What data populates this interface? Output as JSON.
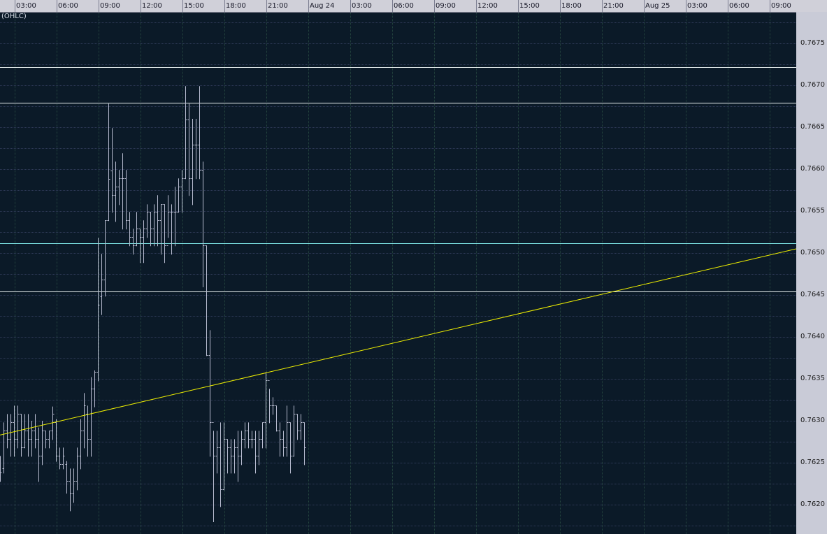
{
  "indicator_label": "(OHLC)",
  "colors": {
    "background": "#0b1a28",
    "bar": "#b8bcd0",
    "trendline": "#f0f000",
    "level_white": "#e8f0f0",
    "level_cyan": "#7fe8e8"
  },
  "chart_data": {
    "type": "ohlc",
    "time_labels": [
      "03:00",
      "06:00",
      "09:00",
      "12:00",
      "15:00",
      "18:00",
      "21:00",
      "Aug 24",
      "03:00",
      "06:00",
      "09:00",
      "12:00",
      "15:00",
      "18:00",
      "21:00",
      "Aug 25",
      "03:00",
      "06:00",
      "09:00"
    ],
    "price_labels": [
      "0.7675",
      "0.7670",
      "0.7665",
      "0.7660",
      "0.7655",
      "0.7650",
      "0.7645",
      "0.7640",
      "0.7635",
      "0.7630",
      "0.7625",
      "0.7620"
    ],
    "ylim": [
      0.76153,
      0.76802
    ],
    "bar_interval_minutes": 15,
    "first_bar_offset_bars": -4.2,
    "bars": [
      [
        0.76248,
        0.76258,
        0.76228,
        0.76238
      ],
      [
        0.76243,
        0.76298,
        0.76238,
        0.76288
      ],
      [
        0.76288,
        0.76308,
        0.76268,
        0.76278
      ],
      [
        0.76278,
        0.76308,
        0.76258,
        0.76298
      ],
      [
        0.76298,
        0.76318,
        0.76258,
        0.76278
      ],
      [
        0.76278,
        0.76318,
        0.76268,
        0.76308
      ],
      [
        0.76308,
        0.76308,
        0.76258,
        0.76268
      ],
      [
        0.76268,
        0.76308,
        0.76268,
        0.76288
      ],
      [
        0.76288,
        0.76308,
        0.76258,
        0.76278
      ],
      [
        0.76278,
        0.763,
        0.76258,
        0.76288
      ],
      [
        0.76288,
        0.76308,
        0.76268,
        0.76278
      ],
      [
        0.76278,
        0.76292,
        0.76228,
        0.76258
      ],
      [
        0.76258,
        0.763,
        0.76248,
        0.76288
      ],
      [
        0.76288,
        0.76288,
        0.76268,
        0.76278
      ],
      [
        0.76278,
        0.76288,
        0.76268,
        0.76288
      ],
      [
        0.76288,
        0.76317,
        0.76278,
        0.76308
      ],
      [
        0.76298,
        0.76302,
        0.76252,
        0.76258
      ],
      [
        0.76258,
        0.76268,
        0.76243,
        0.76248
      ],
      [
        0.76248,
        0.76268,
        0.76243,
        0.76258
      ],
      [
        0.76248,
        0.76252,
        0.76214,
        0.76228
      ],
      [
        0.76228,
        0.76243,
        0.76193,
        0.76213
      ],
      [
        0.76213,
        0.76243,
        0.76203,
        0.76228
      ],
      [
        0.76228,
        0.76268,
        0.76218,
        0.76258
      ],
      [
        0.76258,
        0.76302,
        0.76243,
        0.76288
      ],
      [
        0.76288,
        0.76333,
        0.76268,
        0.76318
      ],
      [
        0.76308,
        0.76318,
        0.76258,
        0.76278
      ],
      [
        0.76278,
        0.76352,
        0.76258,
        0.76338
      ],
      [
        0.76338,
        0.7636,
        0.76317,
        0.76358
      ],
      [
        0.76358,
        0.76518,
        0.76348,
        0.76438
      ],
      [
        0.76448,
        0.76499,
        0.76427,
        0.76468
      ],
      [
        0.76468,
        0.76539,
        0.76449,
        0.76539
      ],
      [
        0.76539,
        0.76678,
        0.76539,
        0.76588
      ],
      [
        0.76598,
        0.76649,
        0.76549,
        0.76569
      ],
      [
        0.76569,
        0.76609,
        0.76538,
        0.76579
      ],
      [
        0.76579,
        0.76599,
        0.76558,
        0.76589
      ],
      [
        0.76589,
        0.76619,
        0.76529,
        0.76589
      ],
      [
        0.76589,
        0.76599,
        0.76529,
        0.76539
      ],
      [
        0.76539,
        0.76549,
        0.76509,
        0.76519
      ],
      [
        0.76519,
        0.76529,
        0.76499,
        0.76509
      ],
      [
        0.76509,
        0.76549,
        0.76509,
        0.76529
      ],
      [
        0.76529,
        0.76529,
        0.76489,
        0.76519
      ],
      [
        0.76519,
        0.76539,
        0.76489,
        0.76529
      ],
      [
        0.76529,
        0.76558,
        0.76519,
        0.76549
      ],
      [
        0.76549,
        0.76549,
        0.76509,
        0.76529
      ],
      [
        0.76529,
        0.76558,
        0.76509,
        0.76549
      ],
      [
        0.76549,
        0.76569,
        0.76509,
        0.76539
      ],
      [
        0.76539,
        0.76558,
        0.76499,
        0.76558
      ],
      [
        0.76558,
        0.76558,
        0.76489,
        0.76509
      ],
      [
        0.76509,
        0.76569,
        0.76519,
        0.76549
      ],
      [
        0.76549,
        0.76558,
        0.76499,
        0.76549
      ],
      [
        0.76549,
        0.76579,
        0.76509,
        0.76549
      ],
      [
        0.76549,
        0.76589,
        0.76549,
        0.76579
      ],
      [
        0.76579,
        0.76599,
        0.76549,
        0.76589
      ],
      [
        0.76589,
        0.76699,
        0.76589,
        0.76659
      ],
      [
        0.76659,
        0.76678,
        0.76569,
        0.76589
      ],
      [
        0.76589,
        0.7666,
        0.76558,
        0.76629
      ],
      [
        0.76629,
        0.7666,
        0.76589,
        0.76629
      ],
      [
        0.76629,
        0.76699,
        0.76589,
        0.76599
      ],
      [
        0.76599,
        0.76609,
        0.7646,
        0.76509
      ],
      [
        0.76509,
        0.76509,
        0.76378,
        0.76378
      ],
      [
        0.76378,
        0.76408,
        0.76258,
        0.76298
      ],
      [
        0.76298,
        0.76288,
        0.7618,
        0.76258
      ],
      [
        0.76258,
        0.76288,
        0.76238,
        0.76268
      ],
      [
        0.76268,
        0.76298,
        0.76198,
        0.76218
      ],
      [
        0.76218,
        0.76298,
        0.76218,
        0.76278
      ],
      [
        0.76278,
        0.76278,
        0.76238,
        0.76268
      ],
      [
        0.76268,
        0.76278,
        0.76238,
        0.76258
      ],
      [
        0.76258,
        0.76278,
        0.76238,
        0.76268
      ],
      [
        0.76268,
        0.76288,
        0.76228,
        0.76258
      ],
      [
        0.76258,
        0.76288,
        0.76248,
        0.76278
      ],
      [
        0.76278,
        0.76298,
        0.76268,
        0.76288
      ],
      [
        0.76288,
        0.76298,
        0.76268,
        0.76278
      ],
      [
        0.76278,
        0.76288,
        0.76268,
        0.76278
      ],
      [
        0.76278,
        0.76288,
        0.76238,
        0.76258
      ],
      [
        0.76258,
        0.76288,
        0.76248,
        0.76278
      ],
      [
        0.76278,
        0.76298,
        0.76268,
        0.76298
      ],
      [
        0.76298,
        0.76358,
        0.76268,
        0.76348
      ],
      [
        0.76348,
        0.76338,
        0.76298,
        0.76318
      ],
      [
        0.76318,
        0.76328,
        0.76308,
        0.76318
      ],
      [
        0.76318,
        0.76318,
        0.76288,
        0.76288
      ],
      [
        0.76288,
        0.76298,
        0.76258,
        0.76278
      ],
      [
        0.76278,
        0.76288,
        0.76258,
        0.76268
      ],
      [
        0.76268,
        0.76318,
        0.76258,
        0.76298
      ],
      [
        0.76298,
        0.76298,
        0.76238,
        0.76258
      ],
      [
        0.76258,
        0.76318,
        0.76258,
        0.76308
      ],
      [
        0.76308,
        0.76308,
        0.76278,
        0.76288
      ],
      [
        0.76288,
        0.76308,
        0.76278,
        0.76298
      ],
      [
        0.76298,
        0.76298,
        0.76248,
        0.76268
      ]
    ],
    "horizontal_levels": [
      {
        "price": 0.76722,
        "color": "#e8f0f0"
      },
      {
        "price": 0.76679,
        "color": "#e8f0f0"
      },
      {
        "price": 0.76512,
        "color": "#7fe8e8"
      },
      {
        "price": 0.76454,
        "color": "#e8f0f0"
      }
    ],
    "trendline": {
      "start_price": 0.76283,
      "end_price": 0.76505,
      "color": "#f0f000"
    }
  }
}
